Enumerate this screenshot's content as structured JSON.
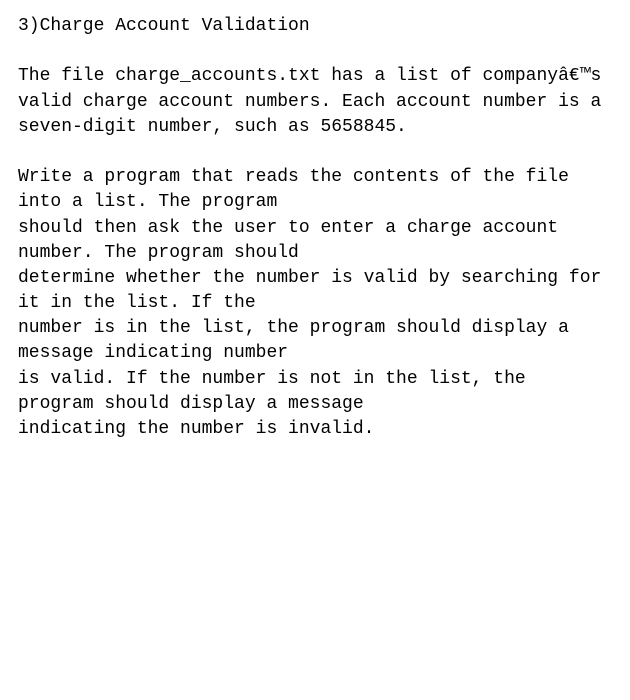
{
  "title": "3)Charge Account Validation",
  "para1": "The file charge_accounts.txt has a list of companyâ€™s valid charge account numbers. Each account number is a seven-digit number, such as 5658845.",
  "para2": "Write a program that reads the contents of the file into a list. The program\nshould then ask the user to enter a charge account number. The program should\ndetermine whether the number is valid by searching for it in the list. If the\nnumber is in the list, the program should display a message indicating number\nis valid. If the number is not in the list, the program should display a message\nindicating the number is invalid."
}
